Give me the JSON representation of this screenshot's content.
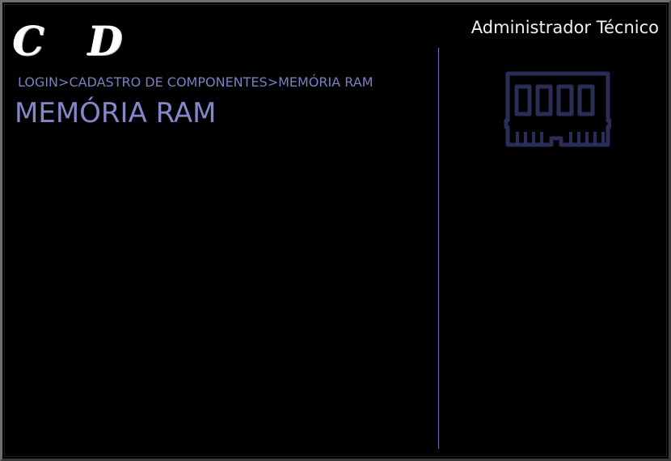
{
  "header": {
    "logo_text": "C D",
    "user_role": "Administrador Técnico"
  },
  "breadcrumb": {
    "items": [
      "LOGIN",
      "CADASTRO DE COMPONENTES",
      "MEMÓRIA RAM"
    ],
    "separator": ">"
  },
  "page": {
    "title": "MEMÓRIA RAM"
  },
  "icons": {
    "component_icon": "ram-memory-icon"
  },
  "colors": {
    "background": "#000000",
    "accent": "#7a7fbf",
    "icon": "#2a2d55",
    "text_primary": "#ffffff"
  }
}
